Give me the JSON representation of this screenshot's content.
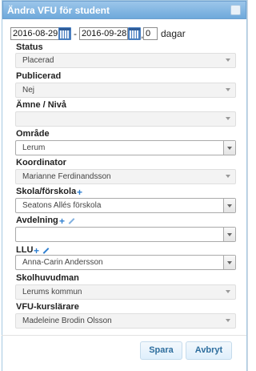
{
  "dialog": {
    "title": "Ändra VFU för student"
  },
  "dates": {
    "start": "2016-08-29",
    "separator": "-",
    "end": "2016-09-28",
    "comma": ",",
    "days": "0",
    "days_label": "dagar"
  },
  "fields": {
    "status": {
      "label": "Status",
      "value": "Placerad"
    },
    "publicerad": {
      "label": "Publicerad",
      "value": "Nej"
    },
    "amne": {
      "label": "Ämne / Nivå",
      "value": ""
    },
    "omrade": {
      "label": "Område",
      "value": "Lerum"
    },
    "koordinator": {
      "label": "Koordinator",
      "value": "Marianne Ferdinandsson"
    },
    "skola": {
      "label": "Skola/förskola",
      "value": "Seatons Allés förskola"
    },
    "avdelning": {
      "label": "Avdelning",
      "value": ""
    },
    "llu": {
      "label": "LLU",
      "value": "Anna-Carin Andersson"
    },
    "skolhuvudman": {
      "label": "Skolhuvudman",
      "value": "Lerums kommun"
    },
    "kurslarare": {
      "label": "VFU-kurslärare",
      "value": "Madeleine Brodin Olsson"
    }
  },
  "buttons": {
    "save": "Spara",
    "cancel": "Avbryt"
  },
  "icons": {
    "calendar": "calendar-icon",
    "add": "plus-icon",
    "edit": "pencil-icon",
    "close": "close-icon",
    "dropdown": "chevron-down-icon"
  }
}
